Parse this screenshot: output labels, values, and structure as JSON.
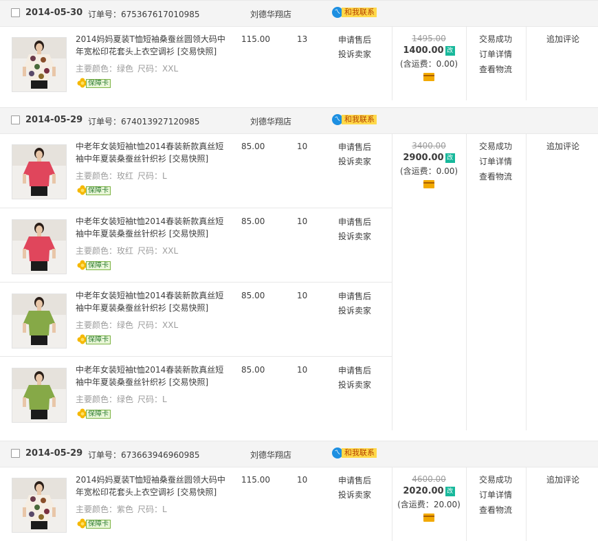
{
  "labels": {
    "order_no_prefix": "订单号：",
    "spec_color_prefix": "主要颜色：",
    "spec_size_prefix": "尺码：",
    "snapshot": "[交易快照]",
    "contact_seller": "和我联系",
    "guarantee_card": "保障卡",
    "after_sale": "申请售后",
    "complain": "投诉卖家",
    "trade_success": "交易成功",
    "order_detail": "订单详情",
    "view_logistics": "查看物流",
    "add_review": "追加评论",
    "shipping_prefix": "(含运费：",
    "shipping_suffix": ")",
    "phone_badge": "改"
  },
  "orders": [
    {
      "date": "2014-05-30",
      "order_no": "675367617010985",
      "shop": "刘德华翔店",
      "original_total": "1495.00",
      "paid_total": "1400.00",
      "shipping": "0.00",
      "items": [
        {
          "title": "2014妈妈夏装T恤短袖桑蚕丝圆领大码中年宽松印花套头上衣空调衫",
          "color": "绿色",
          "size": "XXL",
          "price": "115.00",
          "qty": "13",
          "thumb": "floral"
        }
      ]
    },
    {
      "date": "2014-05-29",
      "order_no": "674013927120985",
      "shop": "刘德华翔店",
      "original_total": "3400.00",
      "paid_total": "2900.00",
      "shipping": "0.00",
      "items": [
        {
          "title": "中老年女装短袖t恤2014春装新款真丝短袖中年夏装桑蚕丝针织衫",
          "color": "玫红",
          "size": "L",
          "price": "85.00",
          "qty": "10",
          "thumb": "#e0465c"
        },
        {
          "title": "中老年女装短袖t恤2014春装新款真丝短袖中年夏装桑蚕丝针织衫",
          "color": "玫红",
          "size": "XXL",
          "price": "85.00",
          "qty": "10",
          "thumb": "#e0465c"
        },
        {
          "title": "中老年女装短袖t恤2014春装新款真丝短袖中年夏装桑蚕丝针织衫",
          "color": "绿色",
          "size": "XXL",
          "price": "85.00",
          "qty": "10",
          "thumb": "#86a947"
        },
        {
          "title": "中老年女装短袖t恤2014春装新款真丝短袖中年夏装桑蚕丝针织衫",
          "color": "绿色",
          "size": "L",
          "price": "85.00",
          "qty": "10",
          "thumb": "#86a947"
        }
      ]
    },
    {
      "date": "2014-05-29",
      "order_no": "673663946960985",
      "shop": "刘德华翔店",
      "original_total": "4600.00",
      "paid_total": "2020.00",
      "shipping": "20.00",
      "items": [
        {
          "title": "2014妈妈夏装T恤短袖桑蚕丝圆领大码中年宽松印花套头上衣空调衫",
          "color": "紫色",
          "size": "L",
          "price": "115.00",
          "qty": "10",
          "thumb": "floral"
        }
      ]
    }
  ]
}
